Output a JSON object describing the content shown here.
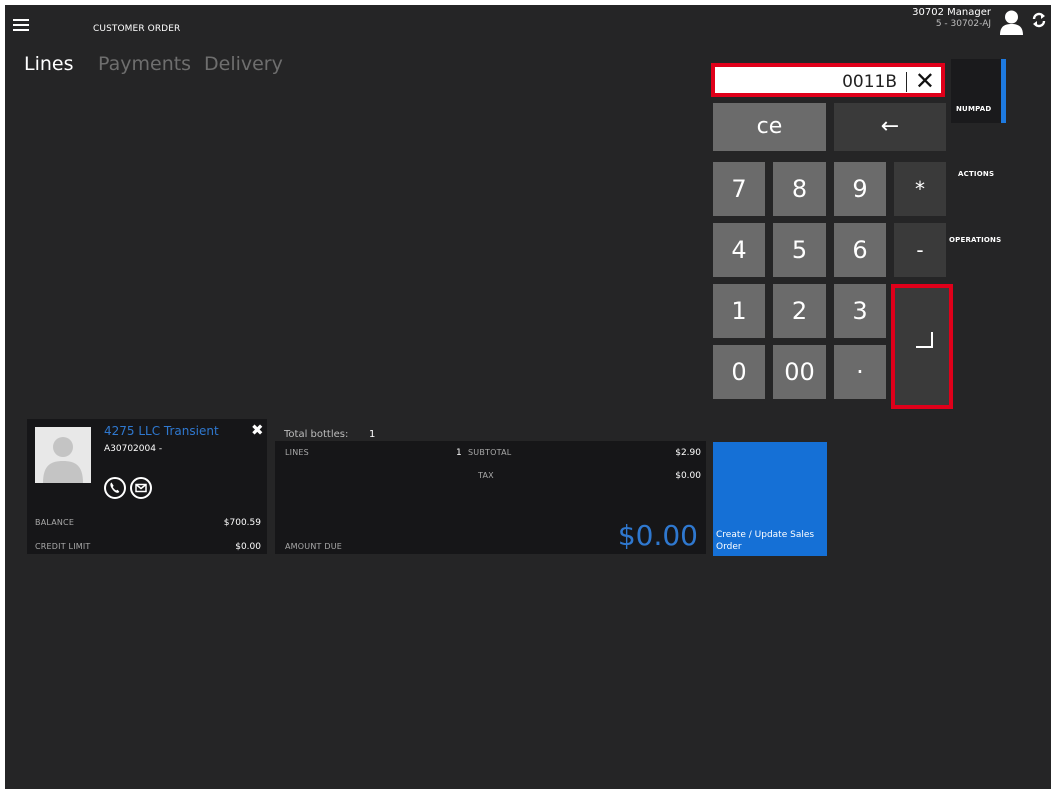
{
  "header": {
    "title": "CUSTOMER ORDER",
    "user_name": "30702 Manager",
    "store": "5 - 30702-AJ"
  },
  "tabs": [
    {
      "label": "Lines",
      "active": true
    },
    {
      "label": "Payments",
      "active": false
    },
    {
      "label": "Delivery",
      "active": false
    }
  ],
  "numpad": {
    "input_value": "0011B",
    "keys": {
      "ce": "ce",
      "backspace": "←",
      "k7": "7",
      "k8": "8",
      "k9": "9",
      "multiply": "*",
      "k4": "4",
      "k5": "5",
      "k6": "6",
      "minus": "-",
      "k1": "1",
      "k2": "2",
      "k3": "3",
      "k0": "0",
      "k00": "00",
      "dot": "·"
    }
  },
  "side_menu": {
    "numpad": "NUMPAD",
    "actions": "ACTIONS",
    "operations": "OPERATIONS"
  },
  "customer": {
    "name": "4275 LLC Transient",
    "account": "A30702004  -",
    "balance_label": "BALANCE",
    "balance": "$700.59",
    "credit_limit_label": "CREDIT LIMIT",
    "credit_limit": "$0.00"
  },
  "totals": {
    "bottles_label": "Total bottles:",
    "bottles": "1",
    "lines_label": "LINES",
    "lines": "1",
    "subtotal_label": "SUBTOTAL",
    "subtotal": "$2.90",
    "tax_label": "TAX",
    "tax": "$0.00",
    "amount_due_label": "AMOUNT DUE",
    "amount_due": "$0.00"
  },
  "action_tile": {
    "label": "Create / Update Sales Order"
  },
  "colors": {
    "accent": "#1570d6",
    "highlight": "#e0001a",
    "background": "#252526"
  }
}
